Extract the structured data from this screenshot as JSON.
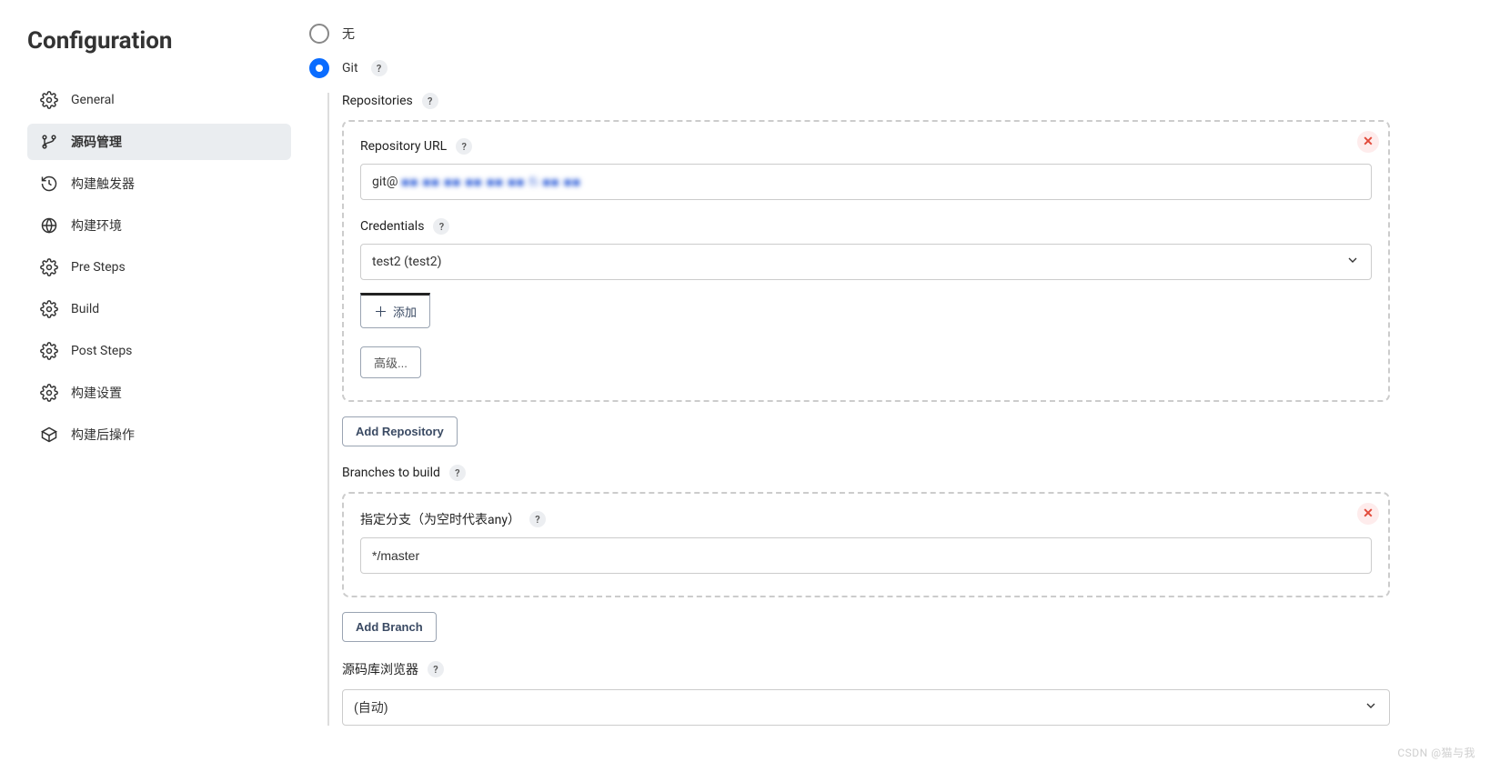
{
  "sidebar": {
    "title": "Configuration",
    "items": [
      {
        "label": "General"
      },
      {
        "label": "源码管理"
      },
      {
        "label": "构建触发器"
      },
      {
        "label": "构建环境"
      },
      {
        "label": "Pre Steps"
      },
      {
        "label": "Build"
      },
      {
        "label": "Post Steps"
      },
      {
        "label": "构建设置"
      },
      {
        "label": "构建后操作"
      }
    ]
  },
  "scm": {
    "none_label": "无",
    "git_label": "Git",
    "repositories_label": "Repositories",
    "repository_url_label": "Repository URL",
    "repository_url_prefix": "git@ ",
    "repository_url_redacted": "■■ ■■ ■■ ■■ ■■ ■■ fi ■■ ■■",
    "credentials_label": "Credentials",
    "credentials_selected": "test2 (test2)",
    "add_credential_label": "添加",
    "advanced_label": "高级...",
    "add_repository_label": "Add Repository",
    "branches_to_build_label": "Branches to build",
    "branch_specifier_label": "指定分支（为空时代表any）",
    "branch_value": "*/master",
    "add_branch_label": "Add Branch",
    "repo_browser_label": "源码库浏览器",
    "repo_browser_selected": "(自动)"
  },
  "watermark": "CSDN @猫与我"
}
